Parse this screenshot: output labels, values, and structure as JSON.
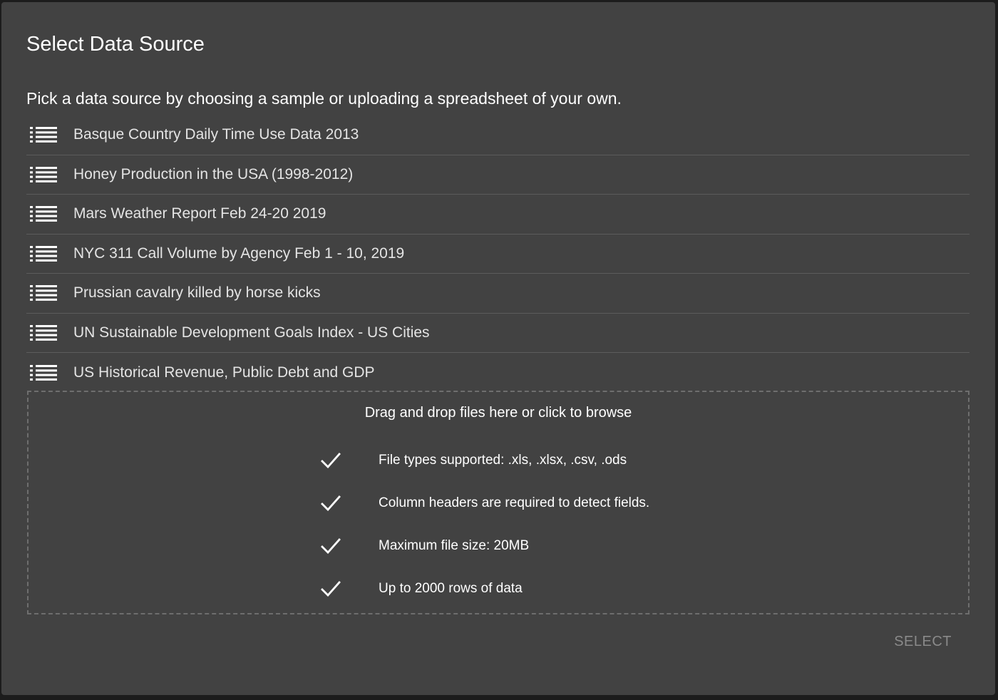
{
  "dialog": {
    "title": "Select Data Source",
    "subtitle": "Pick a data source by choosing a sample or uploading a spreadsheet of your own."
  },
  "sources": [
    {
      "label": "Basque Country Daily Time Use Data 2013",
      "icon": "list-icon"
    },
    {
      "label": "Honey Production in the USA (1998-2012)",
      "icon": "list-icon"
    },
    {
      "label": "Mars Weather Report Feb 24-20 2019",
      "icon": "list-icon"
    },
    {
      "label": "NYC 311 Call Volume by Agency Feb 1 - 10, 2019",
      "icon": "list-icon"
    },
    {
      "label": "Prussian cavalry killed by horse kicks",
      "icon": "list-icon"
    },
    {
      "label": "UN Sustainable Development Goals Index - US Cities",
      "icon": "list-icon"
    },
    {
      "label": "US Historical Revenue, Public Debt and GDP",
      "icon": "list-icon"
    }
  ],
  "dropzone": {
    "title": "Drag and drop files here or click to browse",
    "requirements": [
      {
        "text": "File types supported: .xls, .xlsx, .csv, .ods",
        "icon": "check-icon"
      },
      {
        "text": "Column headers are required to detect fields.",
        "icon": "check-icon"
      },
      {
        "text": "Maximum file size: 20MB",
        "icon": "check-icon"
      },
      {
        "text": "Up to 2000 rows of data",
        "icon": "check-icon"
      }
    ]
  },
  "actions": {
    "select_label": "SELECT",
    "select_enabled": false
  },
  "colors": {
    "dialog_background": "#424242",
    "text_primary": "#ffffff",
    "text_list": "#e4e4e4",
    "divider": "#5c5c5c",
    "disabled_button": "#8a8a8a"
  }
}
